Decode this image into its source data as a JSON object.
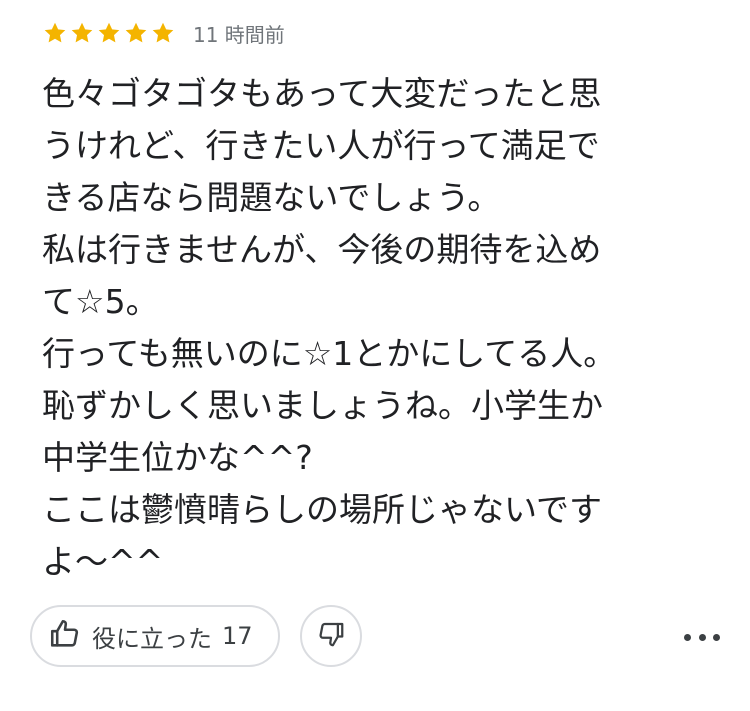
{
  "review": {
    "rating": 5,
    "max_rating": 5,
    "star_color": "#f4b400",
    "time_ago": "11 時間前",
    "lines": [
      "色々ゴタゴタもあって大変だったと思",
      "うけれど、行きたい人が行って満足で",
      "きる店なら問題ないでしょう。",
      "私は行きませんが、今後の期待を込め",
      "て☆5。",
      "行っても無いのに☆1とかにしてる人。",
      "恥ずかしく思いましょうね。小学生か",
      "中学生位かな^^?",
      "ここは鬱憤晴らしの場所じゃないです",
      "よ〜^^"
    ]
  },
  "actions": {
    "helpful_label": "役に立った",
    "helpful_count": "17",
    "helpful_icon": "thumbs-up-icon",
    "unhelpful_icon": "thumbs-down-icon",
    "more_icon": "more-horizontal-icon"
  }
}
